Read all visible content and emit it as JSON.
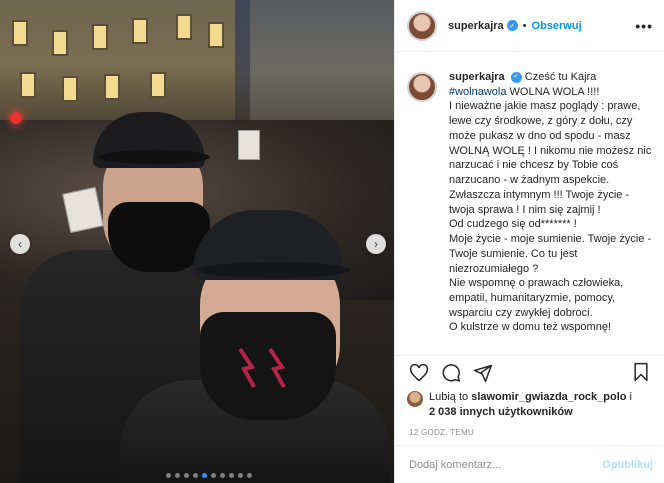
{
  "post": {
    "username": "superkajra",
    "follow_label": "Obserwuj",
    "more_label": "•••",
    "separator": "•"
  },
  "caption": {
    "username": "superkajra",
    "greeting": "Cześć tu Kajra",
    "hashtag": "#wolnawola",
    "text": " WOLNA WOLA !!!!\nI nieważne jakie masz poglądy : prawe, lewe czy środkowe, z góry z dołu, czy może pukasz w dno od spodu - masz WOLNĄ WOLĘ ! I nikomu nie możesz nic narzucać i nie chcesz by Tobie coś narzucano - w żadnym aspekcie. Zwłaszcza intymnym !!! Twoje życie - twoja sprawa ! I nim się zajmij !\nOd cudzego się od******* !\nMoje życie - moje sumienie. Twoje życie - Twoje sumienie. Co tu jest niezrozumiałego ?\nNie wspomnę o prawach człowieka, empatii, humanitaryzmie, pomocy, wsparciu czy zwykłej dobroci.\nO kulstrze w domu też wspomnę!"
  },
  "likes": {
    "prefix": "Lubią to ",
    "user": "slawomir_gwiazda_rock_polo",
    "middle": " i",
    "count": "2 038 innych użytkowników"
  },
  "time_ago": "12 GODZ. TEMU",
  "comment": {
    "placeholder": "Dodaj komentarz...",
    "publish_label": "Opublikuj"
  },
  "carousel": {
    "total_slides": 10,
    "active_slide": 4,
    "prev_symbol": "‹",
    "next_symbol": "›"
  },
  "colors": {
    "accent": "#0095f6",
    "verified": "#3897f0",
    "publish_disabled": "#b2dffc",
    "hashtag": "#00376b",
    "text": "#262626",
    "muted": "#8e8e8e"
  }
}
